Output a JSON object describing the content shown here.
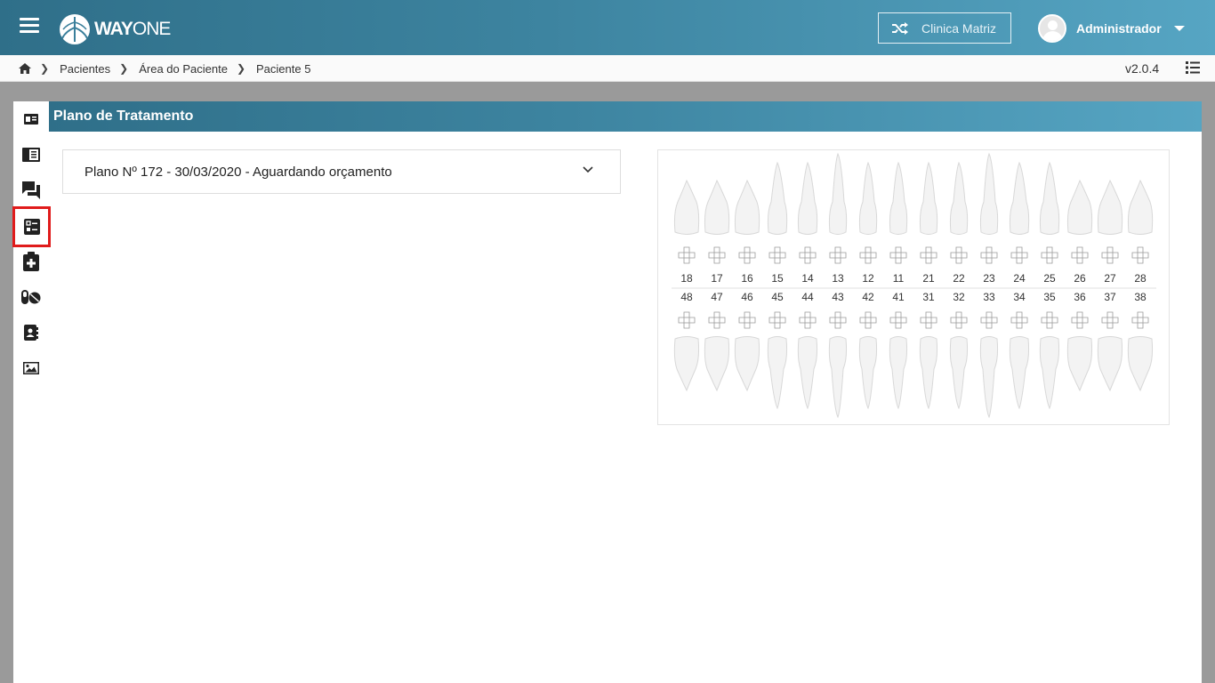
{
  "header": {
    "logo_text_bold": "WAY",
    "logo_text_light": "ONE",
    "clinic_button": "Clinica Matriz",
    "user_name": "Administrador"
  },
  "breadcrumb": {
    "items": [
      "Pacientes",
      "Área do Paciente",
      "Paciente 5"
    ],
    "version": "v2.0.4"
  },
  "section_title": "Plano de Tratamento",
  "plan": {
    "selected": "Plano Nº 172 - 30/03/2020 - Aguardando orçamento"
  },
  "sidebar": {
    "items": [
      {
        "icon": "id-card-icon"
      },
      {
        "icon": "notebook-icon"
      },
      {
        "icon": "chat-icon"
      },
      {
        "icon": "checklist-icon",
        "active": true
      },
      {
        "icon": "clipboard-plus-icon"
      },
      {
        "icon": "pills-icon"
      },
      {
        "icon": "contact-book-icon"
      },
      {
        "icon": "image-icon"
      }
    ]
  },
  "odontogram": {
    "upper": [
      "18",
      "17",
      "16",
      "15",
      "14",
      "13",
      "12",
      "11",
      "21",
      "22",
      "23",
      "24",
      "25",
      "26",
      "27",
      "28"
    ],
    "lower": [
      "48",
      "47",
      "46",
      "45",
      "44",
      "43",
      "42",
      "41",
      "31",
      "32",
      "33",
      "34",
      "35",
      "36",
      "37",
      "38"
    ]
  },
  "colors": {
    "header_gradient_start": "#2f6f89",
    "header_gradient_end": "#56a5c3",
    "active_outline": "#e01b1b"
  }
}
